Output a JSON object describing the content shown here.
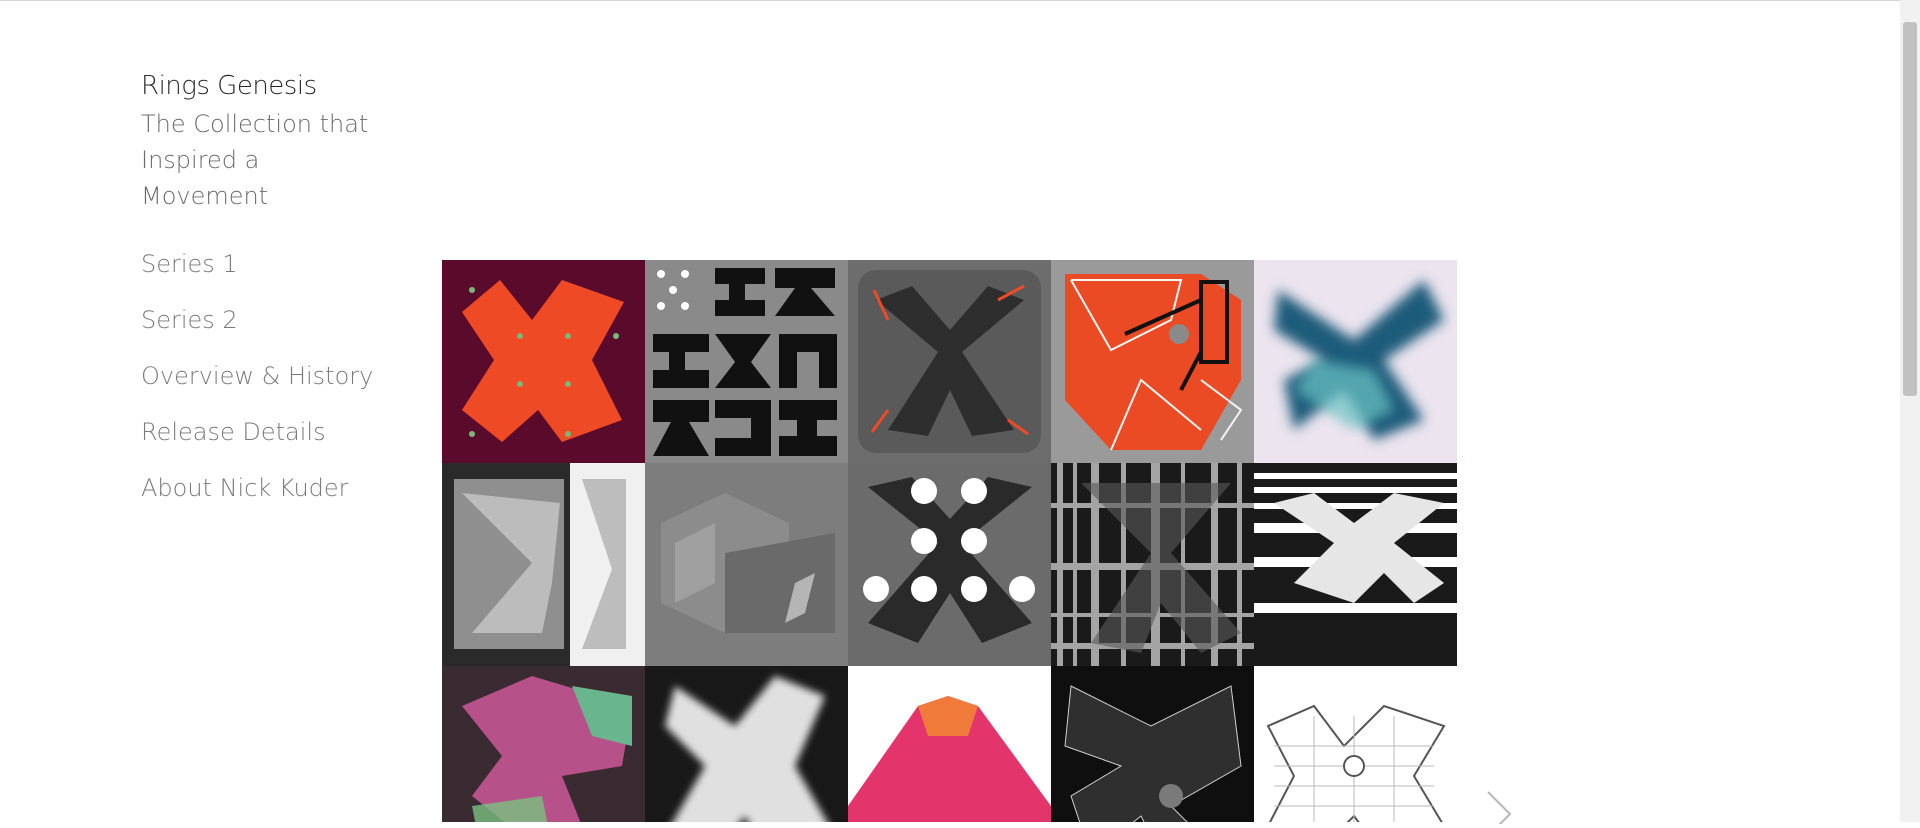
{
  "site": {
    "title": "Rings Genesis",
    "subtitle": "The Collection that Inspired a Movement"
  },
  "nav": {
    "items": [
      {
        "label": "Series 1"
      },
      {
        "label": "Series 2"
      },
      {
        "label": "Overview & History"
      },
      {
        "label": "Release Details"
      },
      {
        "label": "About Nick Kuder"
      }
    ]
  },
  "gallery": {
    "tiles": [
      {
        "name": "artwork-orange-maroon-dots",
        "bg": "#5a0a2a",
        "fg": "#ef4a26"
      },
      {
        "name": "artwork-black-glyph-grid",
        "bg": "#8a8a8a",
        "fg": "#111111"
      },
      {
        "name": "artwork-gray-dark-x",
        "bg": "#6d6d6d",
        "fg": "#3a3a3a"
      },
      {
        "name": "artwork-orange-lines",
        "bg": "#9a9a9a",
        "fg": "#ea4a24"
      },
      {
        "name": "artwork-teal-blur",
        "bg": "#ece4ee",
        "fg": "#1f5b7a"
      },
      {
        "name": "artwork-gray-splits",
        "bg": "#2a2a2a",
        "fg": "#d8d8d8"
      },
      {
        "name": "artwork-gray-cube",
        "bg": "#7d7d7d",
        "fg": "#9a9a9a"
      },
      {
        "name": "artwork-white-circles",
        "bg": "#6b6b6b",
        "fg": "#2a2a2a"
      },
      {
        "name": "artwork-black-grid",
        "bg": "#1a1a1a",
        "fg": "#bdbdbd"
      },
      {
        "name": "artwork-black-stripes",
        "bg": "#ffffff",
        "fg": "#1a1a1a"
      },
      {
        "name": "artwork-pink-dots",
        "bg": "#3a2a32",
        "fg": "#b6518a"
      },
      {
        "name": "artwork-white-glow",
        "bg": "#181818",
        "fg": "#e0e0e0"
      },
      {
        "name": "artwork-pink-mountain",
        "bg": "#ffffff",
        "fg": "#e3356b"
      },
      {
        "name": "artwork-black-white-outline",
        "bg": "#0f0f0f",
        "fg": "#d0d0d0"
      },
      {
        "name": "artwork-plaid-outline",
        "bg": "#ffffff",
        "fg": "#555555"
      }
    ]
  },
  "colors": {
    "text": "#2a2a2a",
    "muted": "#7a7a7a",
    "accent_orange": "#ef4a26"
  },
  "icons": {
    "next": "chevron-right-icon"
  }
}
